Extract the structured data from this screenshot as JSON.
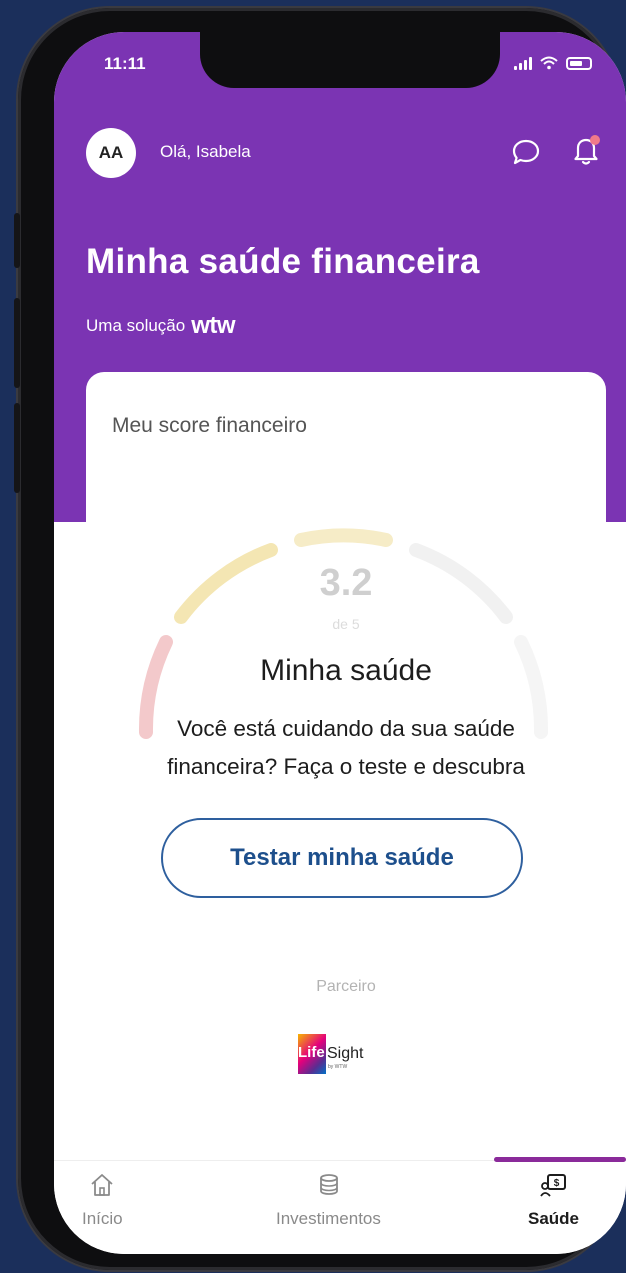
{
  "status_bar": {
    "time": "11:11"
  },
  "header": {
    "avatar_initials": "AA",
    "greeting": "Olá, Isabela",
    "title": "Minha saúde financeira",
    "subtitle_prefix": "Uma solução",
    "subtitle_brand": "wtw"
  },
  "score_card": {
    "title": "Meu score financeiro",
    "score": "3.2",
    "score_scale": "de 5"
  },
  "promo": {
    "title": "Minha saúde",
    "text_line1": "Você está cuidando da sua saúde",
    "text_line2": "financeira? Faça o teste e descubra",
    "button_label": "Testar minha saúde",
    "partner_label": "Parceiro",
    "partner_logo_text_1": "Life",
    "partner_logo_text_2": "Sight",
    "partner_logo_byline": "by WTW"
  },
  "bottom_nav": {
    "items": [
      {
        "label": "Início",
        "icon": "home-icon",
        "active": false
      },
      {
        "label": "Investimentos",
        "icon": "coins-icon",
        "active": false
      },
      {
        "label": "Saúde",
        "icon": "health-finance-icon",
        "active": true
      }
    ]
  },
  "colors": {
    "header_purple": "#7b34b3",
    "background_navy": "#1b2f5b",
    "button_blue": "#1d4f8c",
    "notification_dot": "#f07a8a",
    "active_indicator": "#8a2a9a"
  }
}
